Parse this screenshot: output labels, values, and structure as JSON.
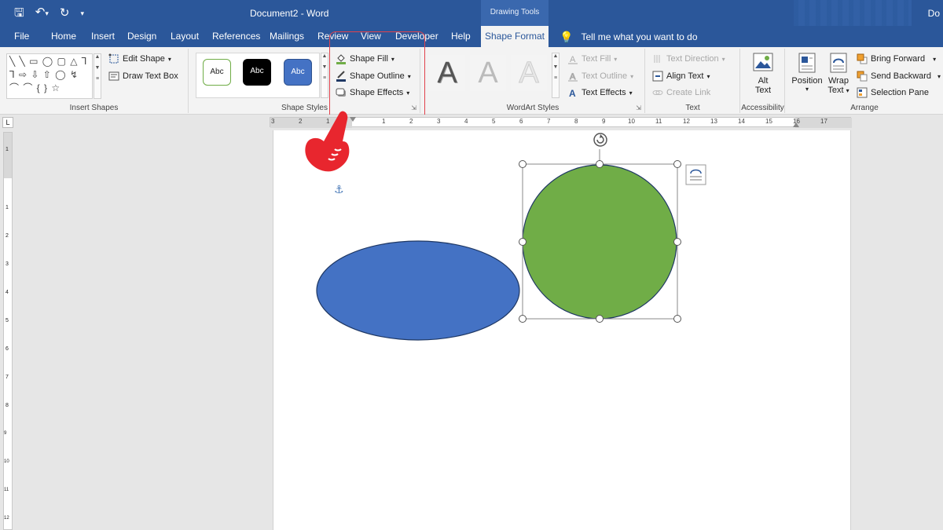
{
  "titlebar": {
    "document_title": "Document2 - Word",
    "contextual_tab_group": "Drawing Tools",
    "user_label": "Do",
    "save_icon": "save-icon",
    "undo_icon": "undo-icon",
    "redo_icon": "redo-icon"
  },
  "tabs": [
    "File",
    "Home",
    "Insert",
    "Design",
    "Layout",
    "References",
    "Mailings",
    "Review",
    "View",
    "Developer",
    "Help",
    "Shape Format"
  ],
  "active_tab": "Shape Format",
  "tell_me": "Tell me what you want to do",
  "ribbon": {
    "insert_shapes": {
      "label": "Insert Shapes",
      "edit_shape": "Edit Shape",
      "draw_text_box": "Draw Text Box",
      "shape_glyphs": "╲ ╲ ▭ ◯ ▢ △ ⅂ ⅂ ⇨ ⇩ ⇧ ◯ ↯ ⌒ ⌒ { } ☆"
    },
    "shape_styles": {
      "label": "Shape Styles",
      "style_sample": "Abc",
      "shape_fill": "Shape Fill",
      "shape_outline": "Shape Outline",
      "shape_effects": "Shape Effects"
    },
    "wordart_styles": {
      "label": "WordArt Styles",
      "letter": "A"
    },
    "text_group": {
      "label": "Text",
      "text_fill": "Text Fill",
      "text_outline": "Text Outline",
      "text_effects": "Text Effects",
      "text_direction": "Text Direction",
      "align_text": "Align Text",
      "create_link": "Create Link"
    },
    "accessibility": {
      "label": "Accessibility",
      "alt_text_line1": "Alt",
      "alt_text_line2": "Text"
    },
    "arrange": {
      "label": "Arrange",
      "position": "Position",
      "wrap_text_line1": "Wrap",
      "wrap_text_line2": "Text",
      "bring_forward": "Bring Forward",
      "send_backward": "Send Backward",
      "selection_pane": "Selection Pane"
    }
  },
  "ruler": {
    "h_labels": [
      "3",
      "2",
      "1",
      "",
      "1",
      "2",
      "3",
      "4",
      "5",
      "6",
      "7",
      "8",
      "9",
      "10",
      "11",
      "12",
      "13",
      "14",
      "15",
      "16",
      "17"
    ],
    "v_labels": [
      "1",
      "",
      "1",
      "2",
      "3",
      "4",
      "5",
      "6",
      "7",
      "8",
      "9",
      "10",
      "11",
      "12"
    ]
  },
  "document": {
    "shapes": [
      {
        "name": "blue-ellipse",
        "fill": "#4472c4",
        "stroke": "#1f3864",
        "selected": false
      },
      {
        "name": "green-circle",
        "fill": "#70ad47",
        "stroke": "#1f3864",
        "selected": true
      }
    ]
  },
  "colors": {
    "brand_blue": "#2b579a",
    "highlight_red": "#e1424d",
    "style_outline_green": "#70ad47",
    "style_black": "#000000",
    "style_blue": "#4472c4"
  }
}
